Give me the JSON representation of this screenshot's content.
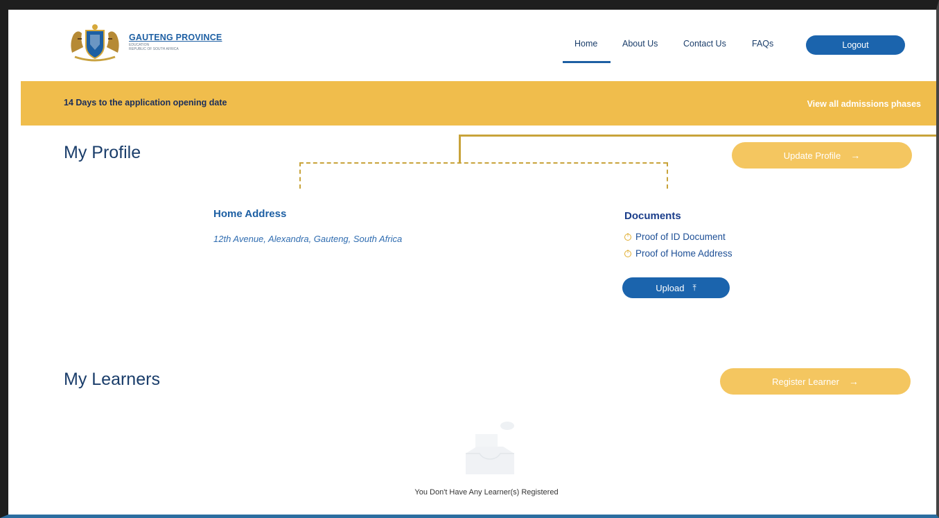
{
  "header": {
    "logo_title": "GAUTENG PROVINCE",
    "logo_subtitle": "EDUCATION",
    "logo_subtitle2": "REPUBLIC OF SOUTH AFRICA",
    "nav": [
      "Home",
      "About Us",
      "Contact Us",
      "FAQs"
    ],
    "active_nav": "Home",
    "logout_label": "Logout"
  },
  "banner": {
    "countdown_text": "14 Days to the application opening date",
    "phases_link": "View all admissions phases"
  },
  "profile": {
    "heading": "My Profile",
    "update_button": "Update Profile",
    "home_address_title": "Home Address",
    "home_address": "12th Avenue, Alexandra, Gauteng, South Africa",
    "documents_title": "Documents",
    "documents": [
      "Proof of ID Document",
      "Proof of Home Address"
    ],
    "upload_button": "Upload"
  },
  "learners": {
    "heading": "My Learners",
    "register_button": "Register Learner",
    "empty_message": "You Don't Have Any Learner(s) Registered"
  },
  "colors": {
    "brand_blue": "#1b64ad",
    "banner_yellow": "#f0bd4c",
    "button_yellow": "#f4c660",
    "accent_gold": "#c8a33a"
  },
  "icons": {
    "logo": "coat-of-arms-icon",
    "update_arrow": "arrow-right-icon",
    "register_arrow": "arrow-right-icon",
    "upload": "upload-icon",
    "document_status": "warning-circle-icon",
    "empty_state": "empty-inbox-icon"
  }
}
